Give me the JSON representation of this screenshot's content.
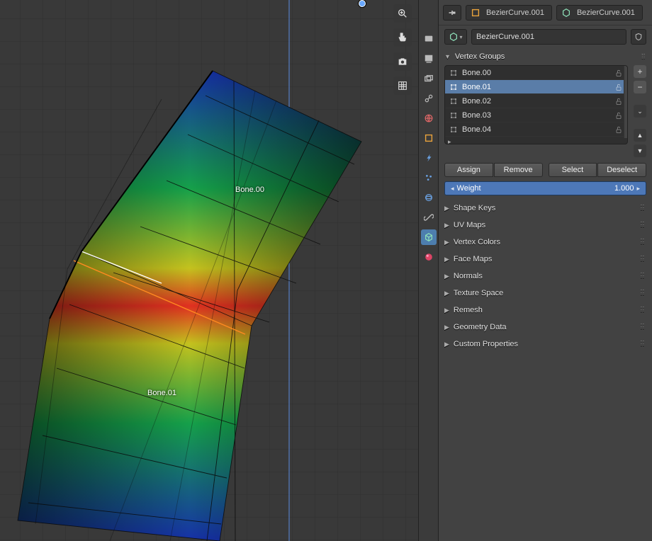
{
  "breadcrumb": {
    "obj": "BezierCurve.001",
    "data": "BezierCurve.001"
  },
  "name_field": "BezierCurve.001",
  "viewport": {
    "bone_labels": [
      "Bone.00",
      "Bone.01"
    ]
  },
  "vertex_groups": {
    "header": "Vertex Groups",
    "items": [
      {
        "name": "Bone.00"
      },
      {
        "name": "Bone.01"
      },
      {
        "name": "Bone.02"
      },
      {
        "name": "Bone.03"
      },
      {
        "name": "Bone.04"
      }
    ],
    "selected_index": 1,
    "buttons": {
      "assign": "Assign",
      "remove": "Remove",
      "select": "Select",
      "deselect": "Deselect"
    },
    "weight_label": "Weight",
    "weight_value": "1.000"
  },
  "panels": [
    "Shape Keys",
    "UV Maps",
    "Vertex Colors",
    "Face Maps",
    "Normals",
    "Texture Space",
    "Remesh",
    "Geometry Data",
    "Custom Properties"
  ],
  "tab_icons": [
    "render",
    "output",
    "view-layer",
    "scene",
    "world",
    "object",
    "modifier",
    "particles",
    "physics",
    "constraints",
    "mesh-data",
    "material",
    "texture"
  ],
  "colors": {
    "accent": "#4d78b8",
    "panel": "#424242",
    "list_bg": "#2f2f2f"
  }
}
